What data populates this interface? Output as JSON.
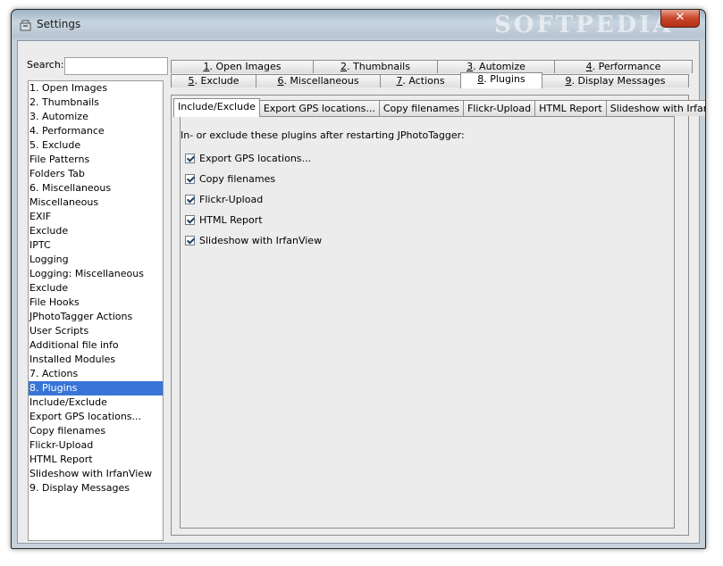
{
  "window": {
    "title": "Settings",
    "close_label": "✕",
    "watermark": "SOFTPEDIA"
  },
  "search": {
    "label": "Search:",
    "value": "",
    "placeholder": ""
  },
  "sidebar": {
    "items": [
      {
        "label": "1. Open Images"
      },
      {
        "label": "2. Thumbnails"
      },
      {
        "label": "3. Automize"
      },
      {
        "label": "4. Performance"
      },
      {
        "label": "5. Exclude"
      },
      {
        "label": "File Patterns"
      },
      {
        "label": "Folders Tab"
      },
      {
        "label": "6. Miscellaneous"
      },
      {
        "label": "Miscellaneous"
      },
      {
        "label": "EXIF"
      },
      {
        "label": "Exclude"
      },
      {
        "label": "IPTC"
      },
      {
        "label": "Logging"
      },
      {
        "label": "Logging: Miscellaneous"
      },
      {
        "label": "Exclude"
      },
      {
        "label": "File Hooks"
      },
      {
        "label": "JPhotoTagger Actions"
      },
      {
        "label": "User Scripts"
      },
      {
        "label": "Additional file info"
      },
      {
        "label": "Installed Modules"
      },
      {
        "label": "7. Actions"
      },
      {
        "label": "8. Plugins",
        "selected": true
      },
      {
        "label": "Include/Exclude"
      },
      {
        "label": "Export GPS locations..."
      },
      {
        "label": "Copy filenames"
      },
      {
        "label": "Flickr-Upload"
      },
      {
        "label": "HTML Report"
      },
      {
        "label": "Slideshow with IrfanView"
      },
      {
        "label": "9. Display Messages"
      }
    ]
  },
  "tabs": {
    "row1": [
      {
        "key": "1",
        "rest": ". Open Images"
      },
      {
        "key": "2",
        "rest": ". Thumbnails"
      },
      {
        "key": "3",
        "rest": ". Automize"
      },
      {
        "key": "4",
        "rest": ". Performance"
      }
    ],
    "row2": [
      {
        "key": "5",
        "rest": ". Exclude"
      },
      {
        "key": "6",
        "rest": ". Miscellaneous"
      },
      {
        "key": "7",
        "rest": ". Actions"
      },
      {
        "key": "8",
        "rest": ". Plugins",
        "active": true
      },
      {
        "key": "9",
        "rest": ". Display Messages"
      }
    ]
  },
  "subtabs": [
    {
      "label": "Include/Exclude",
      "active": true
    },
    {
      "label": "Export GPS locations..."
    },
    {
      "label": "Copy filenames"
    },
    {
      "label": "Flickr-Upload"
    },
    {
      "label": "HTML Report"
    },
    {
      "label": "Slideshow with IrfanView"
    }
  ],
  "plugins": {
    "description": "In- or exclude these plugins after restarting JPhotoTagger:",
    "items": [
      {
        "label": "Export GPS locations...",
        "checked": true
      },
      {
        "label": "Copy filenames",
        "checked": true
      },
      {
        "label": "Flickr-Upload",
        "checked": true
      },
      {
        "label": "HTML Report",
        "checked": true
      },
      {
        "label": "Slideshow with IrfanView",
        "checked": true
      }
    ]
  }
}
